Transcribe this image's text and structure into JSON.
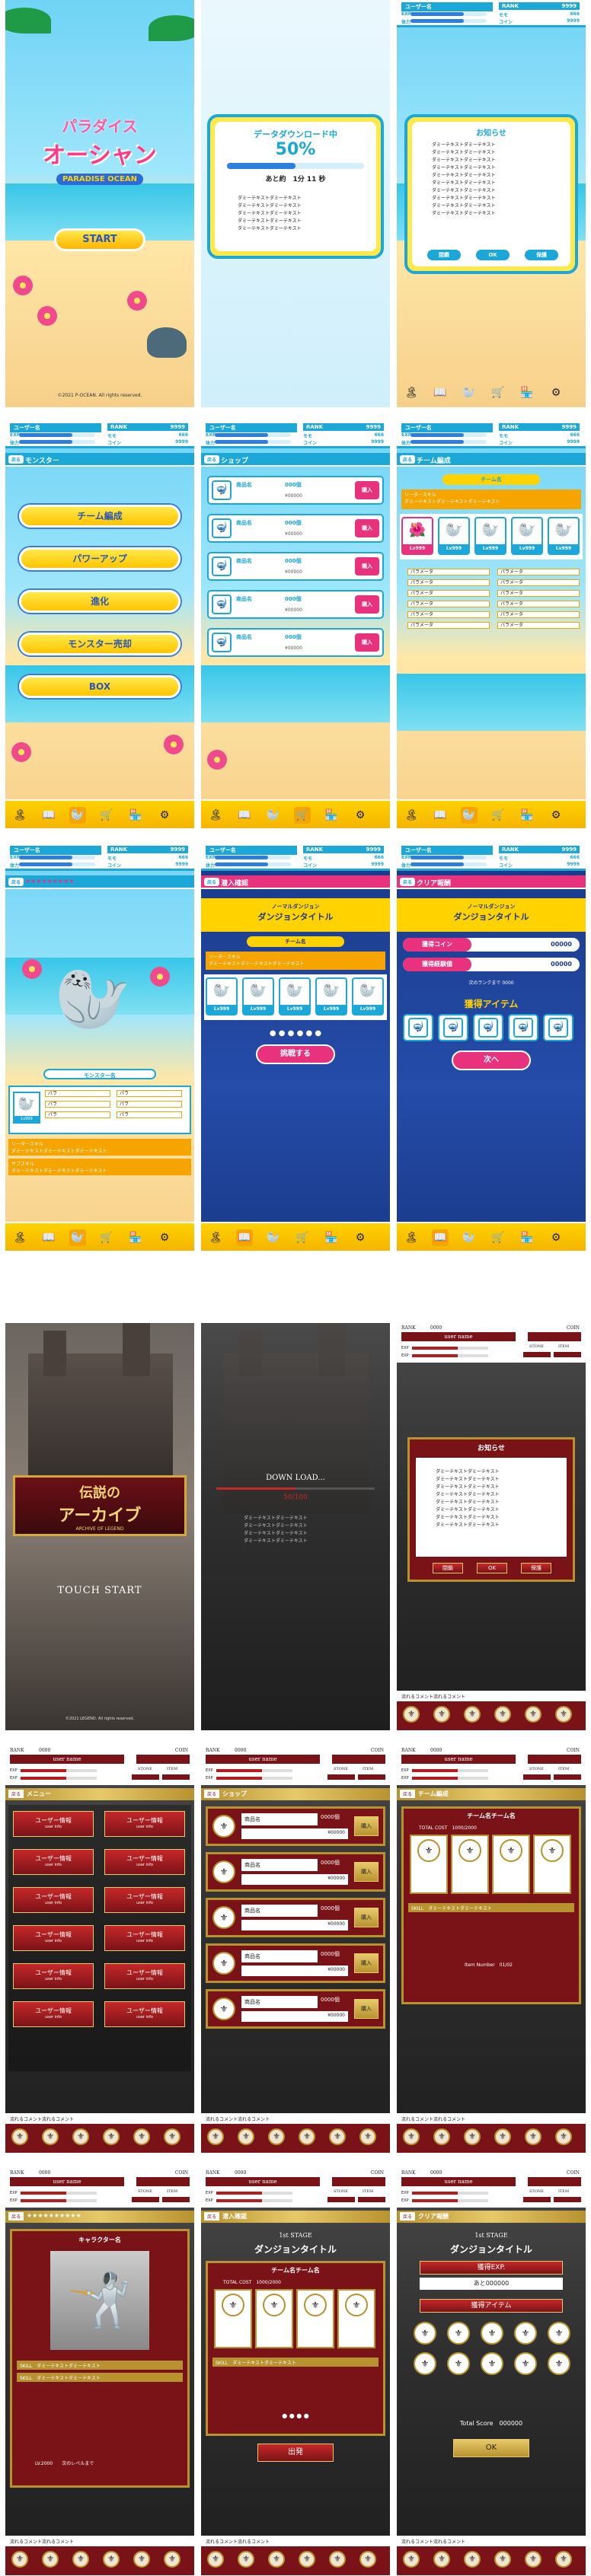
{
  "ocean": {
    "logo_top": "パラダイス",
    "logo_mid": "オーシャン",
    "logo_sub": "PARADISE OCEAN",
    "start": "START",
    "copyright": "©2021 P-OCEAN. All rights reserved.",
    "download_title": "データダウンロード中",
    "download_pct": "50%",
    "download_progress": 0.5,
    "download_remain": "あと約　1分 11 秒",
    "dummy_line": "ダミーテキストダミーテキスト",
    "notice_title": "お知らせ",
    "notice_btn1": "閉鎖",
    "notice_btn2": "OK",
    "notice_btn3": "保護",
    "user": "ユーザー名",
    "rank_label": "RANK",
    "rank_value": "9999",
    "exp_label": "EXP",
    "stamina_label": "体力",
    "monster_label": "モモ",
    "monster_value": "666",
    "coin_label": "コイン",
    "coin_value": "9999",
    "back": "戻る",
    "monster_title": "モンスター",
    "menu": [
      "チーム編成",
      "パワーアップ",
      "進化",
      "モンスター売却",
      "BOX"
    ],
    "shop_title": "ショップ",
    "item_name": "商品名",
    "item_qty": "000個",
    "item_price": "¥00000",
    "buy": "購入",
    "team_title": "チーム編成",
    "team_name": "チーム名",
    "leader_skill": "リーダースキル",
    "skill_label": "サブスキル",
    "skill_dummy": "ダミーテキストダミーテキストダミーテキスト",
    "level": "Lv999",
    "param": "パラメータ",
    "param_value": "0000",
    "monster_name": "モンスター名",
    "stars": "★★★★★★★★★",
    "para_label": "パラ",
    "dive_title": "潜入確認",
    "normal_dungeon": "ノーマルダンジョン",
    "dungeon_title": "ダンジョンタイトル",
    "depart": "挑戦する",
    "clear_title": "クリア報酬",
    "gain_coin": "獲得コイン",
    "gain_exp": "獲得経験値",
    "gain_value": "00000",
    "next_rank": "次のランクまで",
    "next_rank_value": "0000",
    "gain_item": "獲得アイテム",
    "next": "次へ"
  },
  "dark": {
    "logo_line1": "伝説の",
    "logo_line2": "アーカイブ",
    "logo_sub": "ARCHIVE OF LEGEND",
    "touch_start": "TOUCH START",
    "copyright": "©2021 LEGEND. All rights reserved.",
    "download": "DOWN LOAD...",
    "download_count": "50/100",
    "dummy_line": "ダミーテキストダミーテキスト",
    "notice_title": "お知らせ",
    "btn_close": "閉鎖",
    "btn_ok": "OK",
    "btn_protect": "保護",
    "comment": "流れるコメント流れるコメント",
    "rank_label": "RANK",
    "rank_value": "0000",
    "coin_label": "COIN",
    "user": "user name",
    "stone": "STONE",
    "item": "ITEM",
    "back": "戻る",
    "menu_title": "メニュー",
    "menu_item": "ユーザー情報",
    "menu_sub": "user info",
    "shop_title": "ショップ",
    "item_name": "商品名",
    "item_qty": "0000個",
    "item_price": "¥00000",
    "buy": "購入",
    "team_title": "チーム編成",
    "team_name": "チーム名チーム名",
    "total_cost": "TOTAL COST",
    "cost_value": "1000/2000",
    "skill": "SKILL",
    "skill_dummy": "ダミーテキストダミーテキスト",
    "item_number": "Item Number",
    "item_number_value": "01/02",
    "chara_name": "キャラクター名",
    "stars": "★★★★★★★★★★",
    "lv": "LV.2000",
    "next_exp": "次のレベルまで",
    "dive_title": "潜入確認",
    "stage": "1st STAGE",
    "dungeon_title": "ダンジョンタイトル",
    "depart": "出発",
    "clear_title": "クリア報酬",
    "gain_exp": "獲得EXP.",
    "gain_exp_value": "あと000000",
    "gain_item": "獲得アイテム",
    "total_score": "Total Score",
    "total_score_value": "000000",
    "ok": "OK"
  }
}
